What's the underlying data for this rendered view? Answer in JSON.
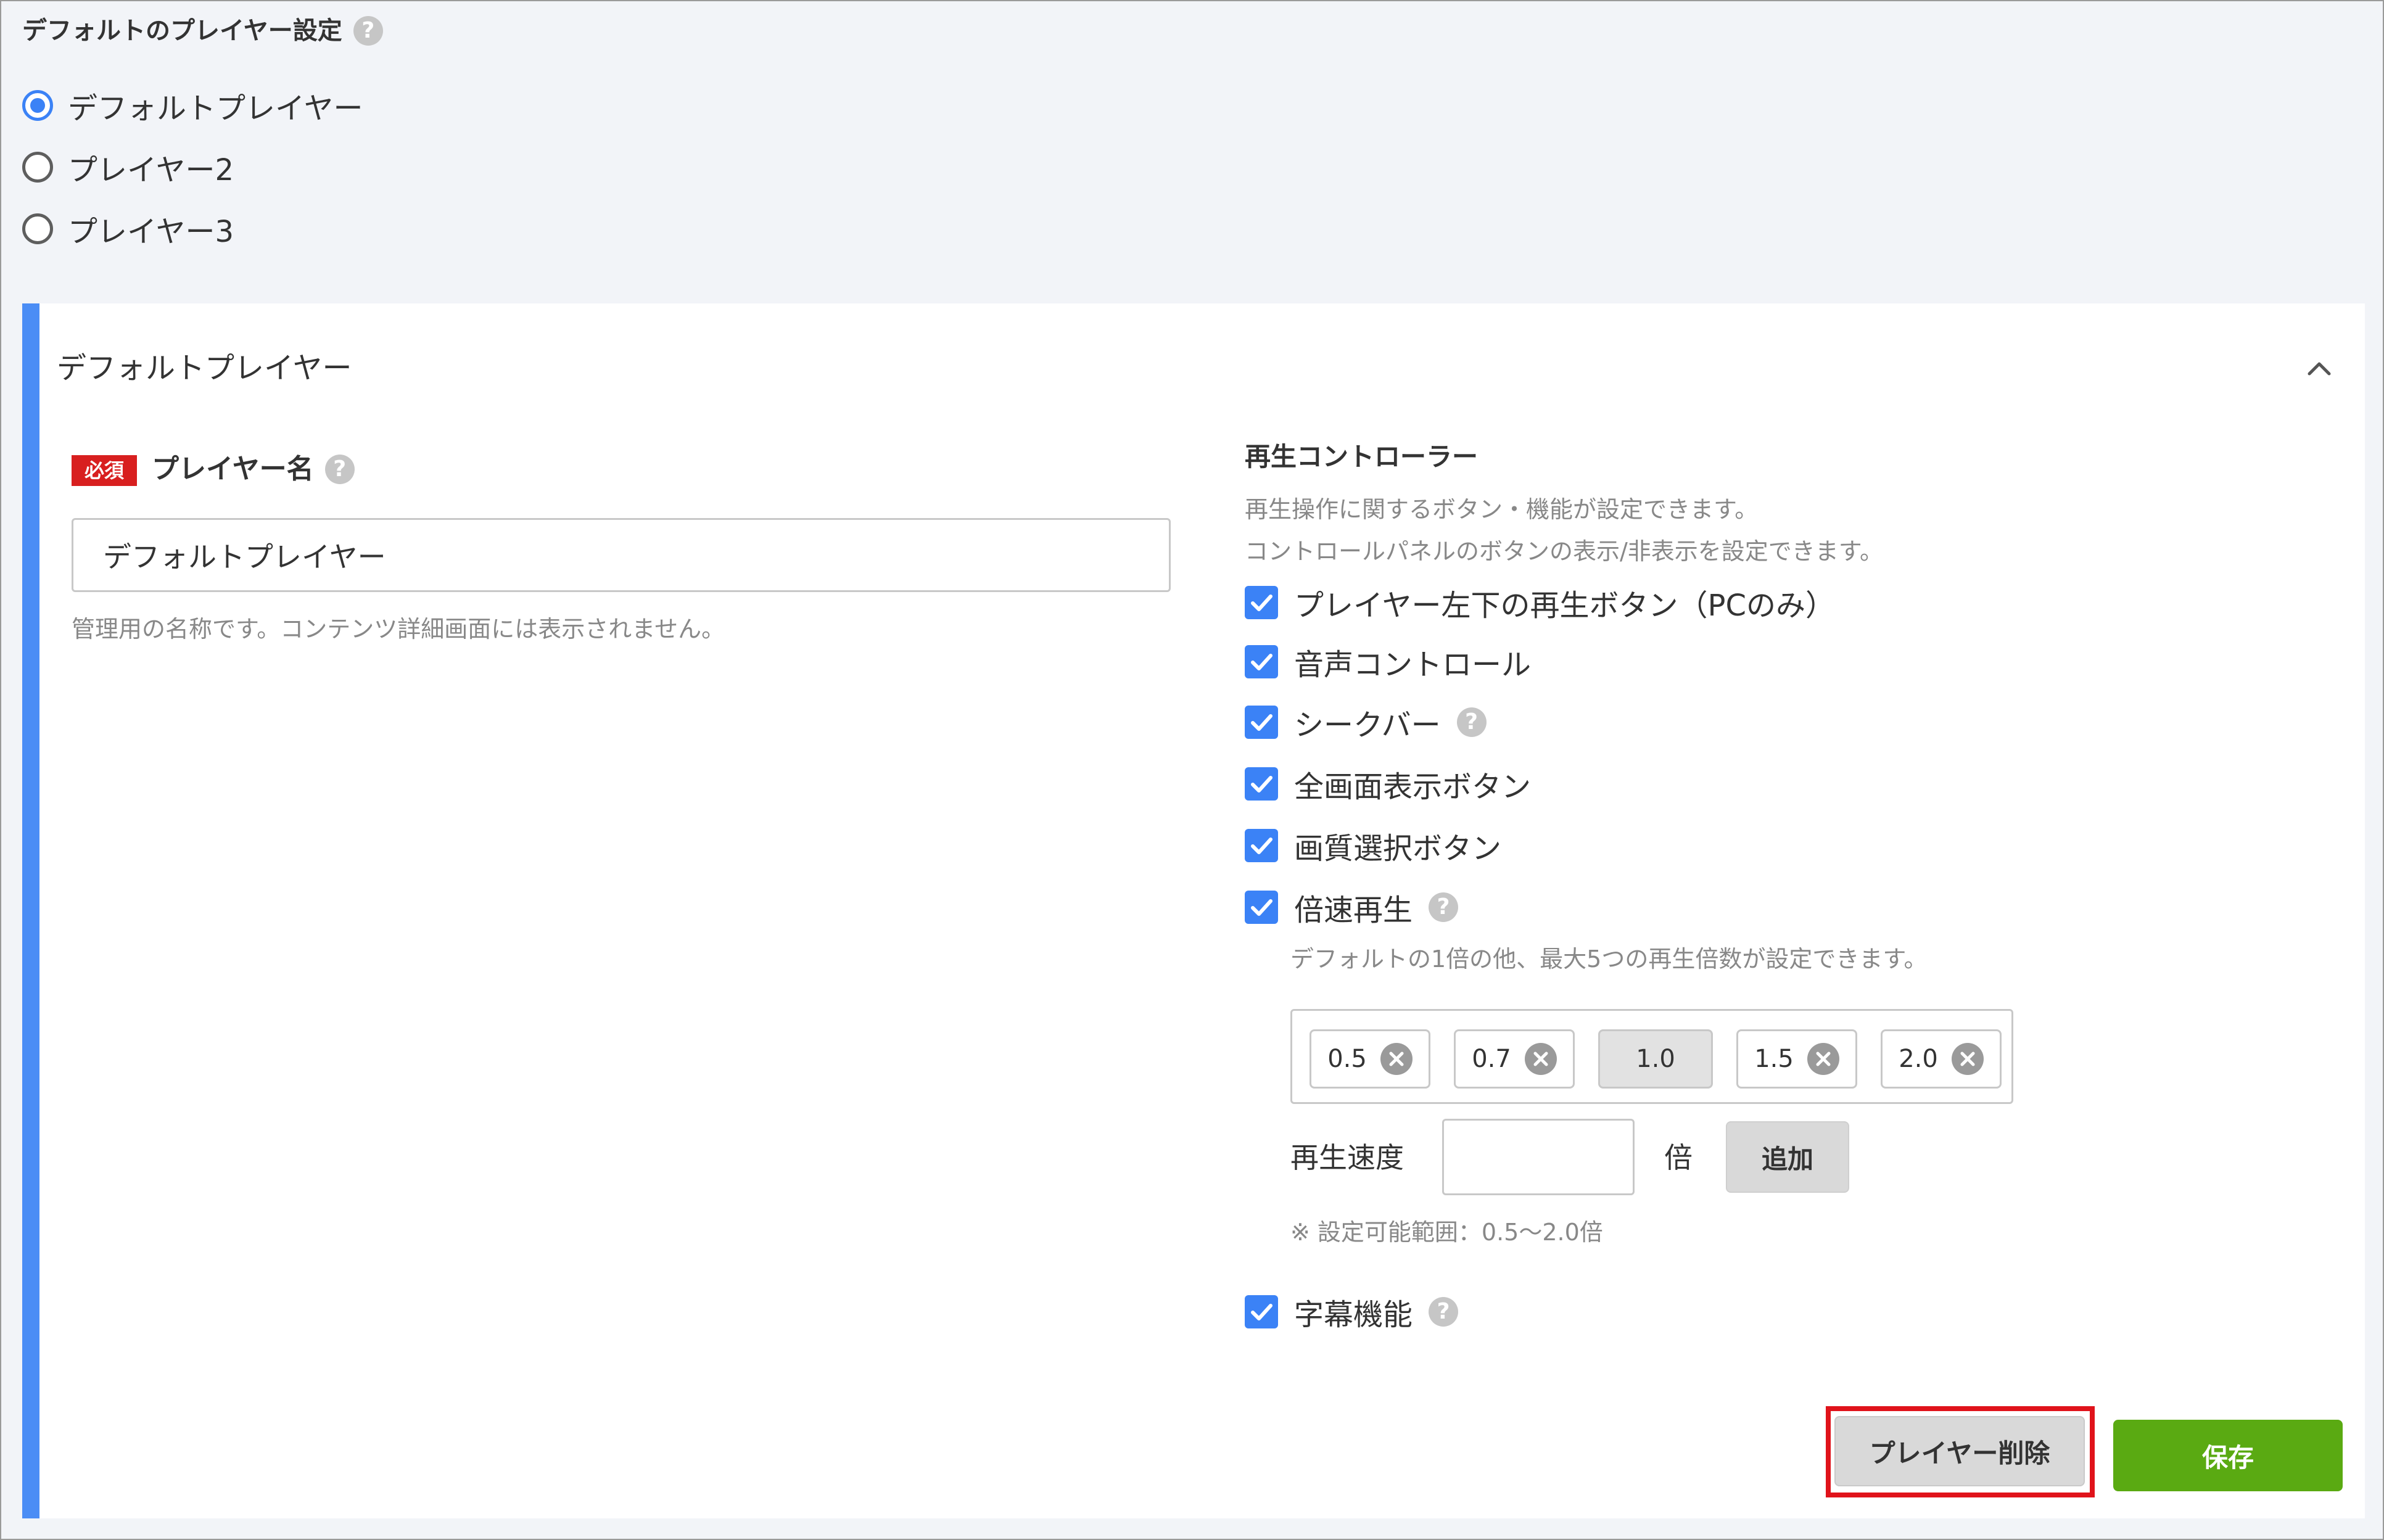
{
  "default_player_setting": {
    "title": "デフォルトのプレイヤー設定",
    "options": [
      {
        "label": "デフォルトプレイヤー",
        "selected": true
      },
      {
        "label": "プレイヤー2",
        "selected": false
      },
      {
        "label": "プレイヤー3",
        "selected": false
      }
    ]
  },
  "panel": {
    "title": "デフォルトプレイヤー",
    "accent_color": "#4b8df5",
    "collapse_icon": "chevron-up-icon"
  },
  "player_name": {
    "required_badge": "必須",
    "label": "プレイヤー名",
    "value": "デフォルトプレイヤー",
    "help": "管理用の名称です。コンテンツ詳細画面には表示されません。"
  },
  "controller": {
    "title": "再生コントローラー",
    "desc_1": "再生操作に関するボタン・機能が設定できます。",
    "desc_2": "コントロールパネルのボタンの表示/非表示を設定できます。",
    "checkboxes": [
      {
        "label": "プレイヤー左下の再生ボタン（PCのみ）",
        "checked": true
      },
      {
        "label": "音声コントロール",
        "checked": true
      },
      {
        "label": "シークバー",
        "checked": true
      },
      {
        "label": "全画面表示ボタン",
        "checked": true
      },
      {
        "label": "画質選択ボタン",
        "checked": true
      },
      {
        "label": "倍速再生",
        "checked": true
      },
      {
        "label": "字幕機能",
        "checked": true
      }
    ],
    "checkbox_color": "#3b82f6"
  },
  "speed": {
    "help": "デフォルトの1倍の他、最大5つの再生倍数が設定できます。",
    "chips": [
      "0.5",
      "0.7",
      "1.0",
      "1.5",
      "2.0"
    ],
    "label": "再生速度",
    "input_value": "",
    "unit": "倍",
    "add_label": "追加",
    "range_note": "※ 設定可能範囲：0.5〜2.0倍"
  },
  "actions": {
    "delete_label": "プレイヤー削除",
    "save_label": "保存",
    "save_color": "#5aaa12",
    "highlight_color": "#e0131b"
  },
  "help_icon": "?"
}
